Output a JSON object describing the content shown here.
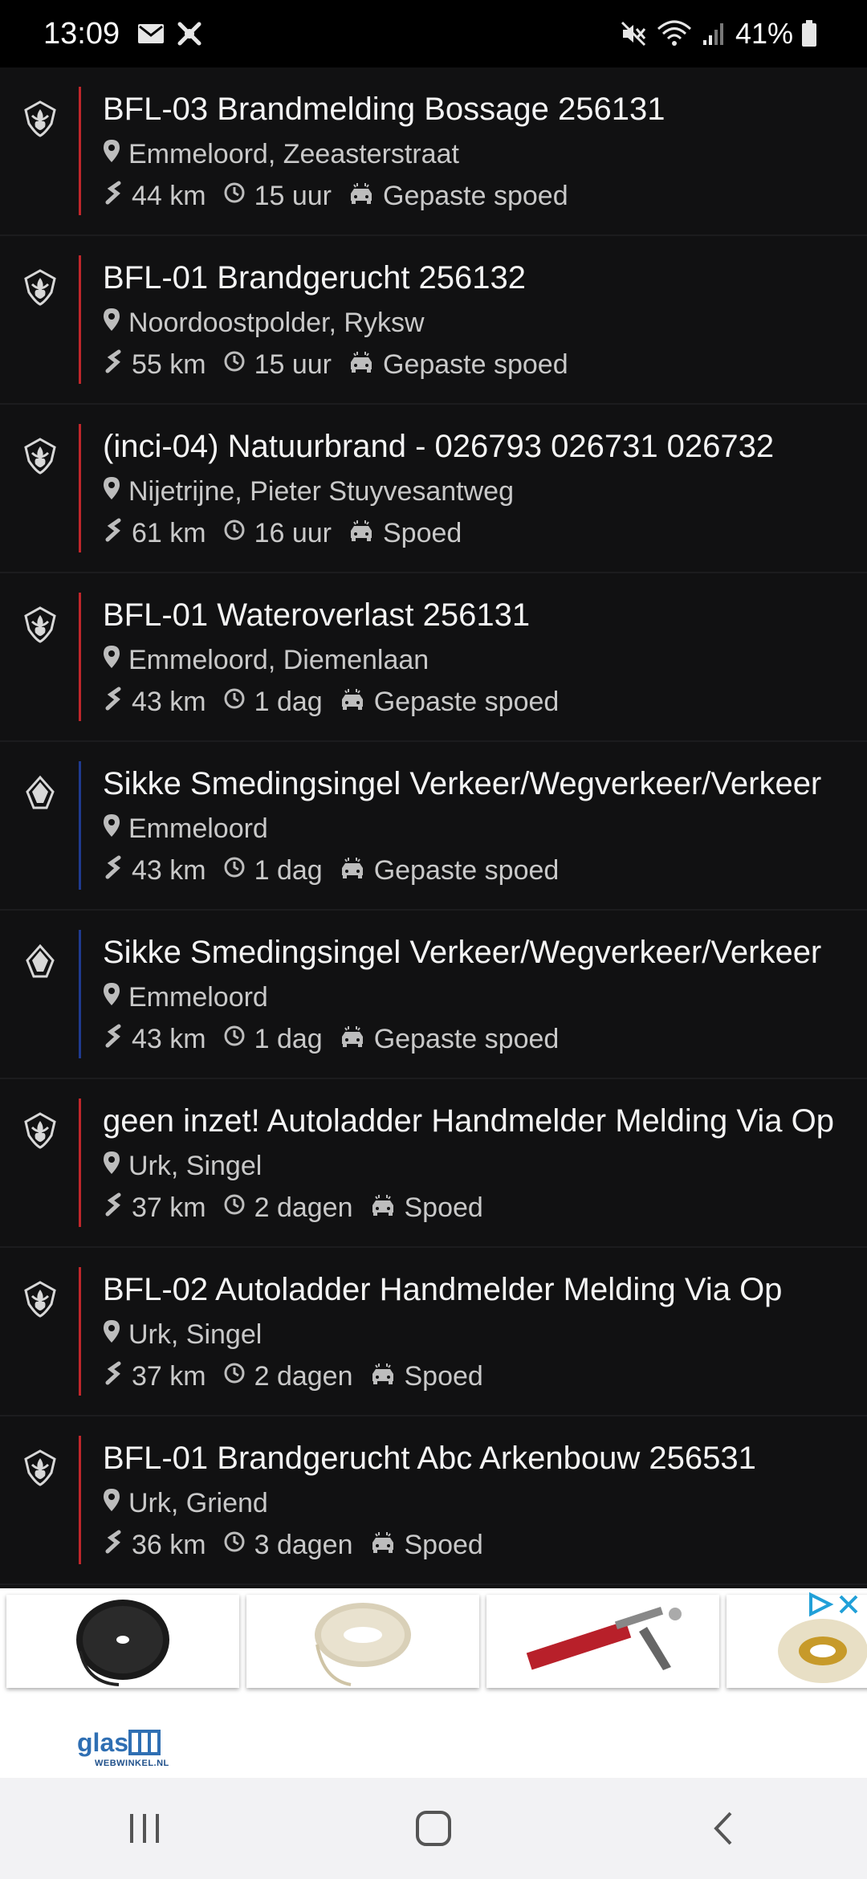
{
  "status_bar": {
    "time": "13:09",
    "battery": "41%",
    "icons": [
      "mail-icon",
      "app-notification-icon",
      "mute-icon",
      "wifi-icon",
      "signal-icon",
      "battery-icon"
    ]
  },
  "colors": {
    "fire": "#c0262b",
    "police": "#1f3a8f"
  },
  "incidents": [
    {
      "title": "BFL-03 Brandmelding Bossage 256131",
      "location": "Emmeloord, Zeeasterstraat",
      "distance": "44 km",
      "time": "15 uur",
      "urgency": "Gepaste spoed",
      "service": "brandweer"
    },
    {
      "title": "BFL-01 Brandgerucht 256132",
      "location": "Noordoostpolder, Ryksw",
      "distance": "55 km",
      "time": "15 uur",
      "urgency": "Gepaste spoed",
      "service": "brandweer"
    },
    {
      "title": "(inci-04) Natuurbrand - 026793 026731 026732",
      "location": "Nijetrijne, Pieter Stuyvesantweg",
      "distance": "61 km",
      "time": "16 uur",
      "urgency": "Spoed",
      "service": "brandweer"
    },
    {
      "title": "BFL-01 Wateroverlast 256131",
      "location": "Emmeloord, Diemenlaan",
      "distance": "43 km",
      "time": "1 dag",
      "urgency": "Gepaste spoed",
      "service": "brandweer"
    },
    {
      "title": "Sikke Smedingsingel Verkeer/Wegverkeer/Verkeer",
      "location": "Emmeloord",
      "distance": "43 km",
      "time": "1 dag",
      "urgency": "Gepaste spoed",
      "service": "politie"
    },
    {
      "title": "Sikke Smedingsingel Verkeer/Wegverkeer/Verkeer",
      "location": "Emmeloord",
      "distance": "43 km",
      "time": "1 dag",
      "urgency": "Gepaste spoed",
      "service": "politie"
    },
    {
      "title": "geen inzet! Autoladder Handmelder Melding Via Op",
      "location": "Urk, Singel",
      "distance": "37 km",
      "time": "2 dagen",
      "urgency": "Spoed",
      "service": "brandweer"
    },
    {
      "title": "BFL-02 Autoladder Handmelder Melding Via Op",
      "location": "Urk, Singel",
      "distance": "37 km",
      "time": "2 dagen",
      "urgency": "Spoed",
      "service": "brandweer"
    },
    {
      "title": "BFL-01 Brandgerucht Abc Arkenbouw 256531",
      "location": "Urk, Griend",
      "distance": "36 km",
      "time": "3 dagen",
      "urgency": "Spoed",
      "service": "brandweer"
    }
  ],
  "ad": {
    "brand_word": "glas",
    "brand_sub": "WEBWINKEL.NL",
    "products": [
      "black-tape-roll",
      "cream-tape-roll",
      "caulking-gun",
      "tape-rolls"
    ]
  },
  "nav": [
    "recents-button",
    "home-button",
    "back-button"
  ]
}
